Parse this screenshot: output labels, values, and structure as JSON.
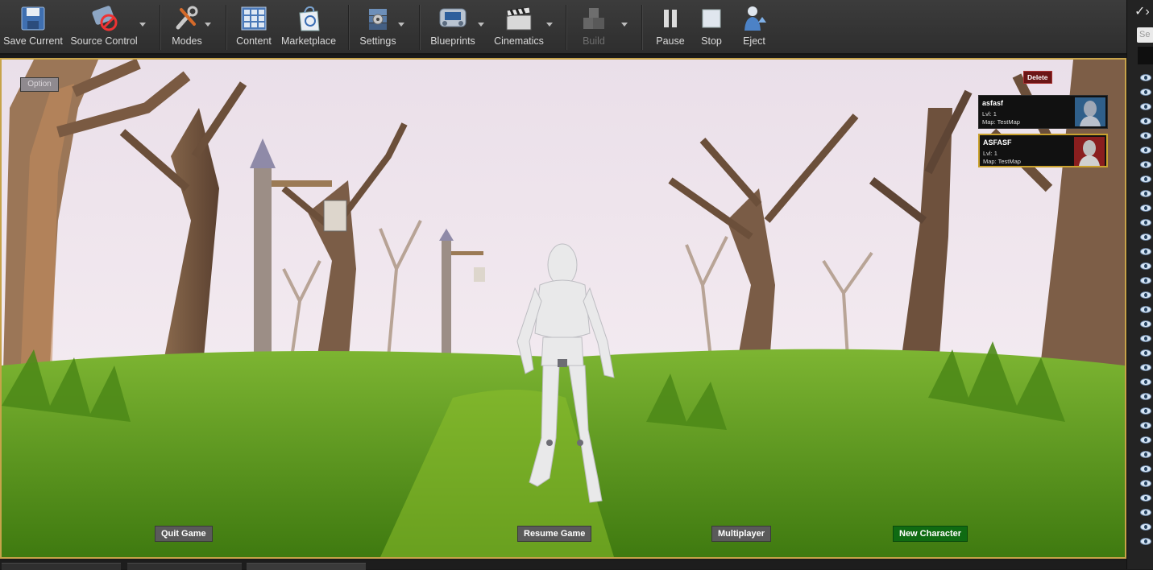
{
  "toolbar": {
    "save_current": "Save Current",
    "source_control": "Source Control",
    "modes": "Modes",
    "content": "Content",
    "marketplace": "Marketplace",
    "settings": "Settings",
    "blueprints": "Blueprints",
    "cinematics": "Cinematics",
    "build": "Build",
    "pause": "Pause",
    "stop": "Stop",
    "eject": "Eject"
  },
  "right_panel": {
    "search_placeholder": "Se"
  },
  "game_ui": {
    "option": "Option",
    "delete": "Delete",
    "characters": [
      {
        "name": "asfasf",
        "level": "Lvl: 1",
        "map": "Map:  TestMap",
        "portrait_color": "#2f5f8a"
      },
      {
        "name": "ASFASF",
        "level": "Lvl: 1",
        "map": "Map:  TestMap",
        "portrait_color": "#8a1e1e"
      }
    ],
    "quit_game": "Quit Game",
    "resume_game": "Resume Game",
    "multiplayer": "Multiplayer",
    "new_character": "New Character",
    "new_character_color": "#0f6b12"
  },
  "colors": {
    "viewport_border": "#c7a34a",
    "selected_card_border": "#c9a12e"
  }
}
